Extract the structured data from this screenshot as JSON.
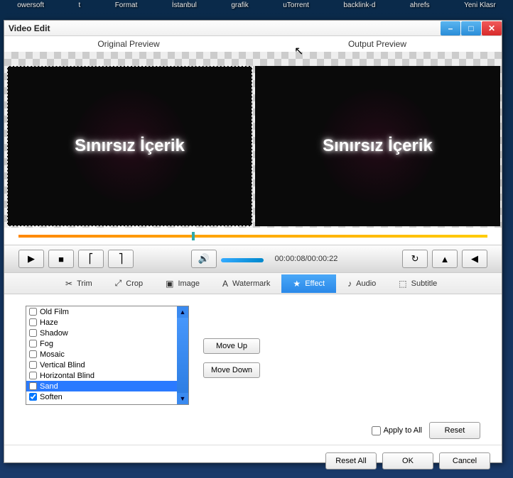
{
  "desktop": {
    "icons": [
      "owersoft",
      "t",
      "Format",
      "İstanbul",
      "grafik",
      "uTorrent",
      "backlink-d",
      "ahrefs",
      "Yeni Klasr"
    ]
  },
  "window": {
    "title": "Video Edit"
  },
  "preview": {
    "original_label": "Original Preview",
    "output_label": "Output Preview",
    "content_text": "Sınırsız İçerik"
  },
  "playback": {
    "time": "00:00:08/00:00:22"
  },
  "tabs": {
    "items": [
      {
        "icon": "✂",
        "label": "Trim"
      },
      {
        "icon": "⤢",
        "label": "Crop"
      },
      {
        "icon": "▣",
        "label": "Image"
      },
      {
        "icon": "A",
        "label": "Watermark"
      },
      {
        "icon": "★",
        "label": "Effect"
      },
      {
        "icon": "♪",
        "label": "Audio"
      },
      {
        "icon": "⬚",
        "label": "Subtitle"
      }
    ],
    "active_index": 4
  },
  "effects": {
    "items": [
      {
        "label": "Old Film",
        "checked": false,
        "selected": false
      },
      {
        "label": "Haze",
        "checked": false,
        "selected": false
      },
      {
        "label": "Shadow",
        "checked": false,
        "selected": false
      },
      {
        "label": "Fog",
        "checked": false,
        "selected": false
      },
      {
        "label": "Mosaic",
        "checked": false,
        "selected": false
      },
      {
        "label": "Vertical Blind",
        "checked": false,
        "selected": false
      },
      {
        "label": "Horizontal Blind",
        "checked": false,
        "selected": false
      },
      {
        "label": "Sand",
        "checked": false,
        "selected": true
      },
      {
        "label": "Soften",
        "checked": true,
        "selected": false
      }
    ],
    "move_up": "Move Up",
    "move_down": "Move Down"
  },
  "buttons": {
    "apply_all": "Apply to All",
    "reset": "Reset",
    "reset_all": "Reset All",
    "ok": "OK",
    "cancel": "Cancel"
  }
}
